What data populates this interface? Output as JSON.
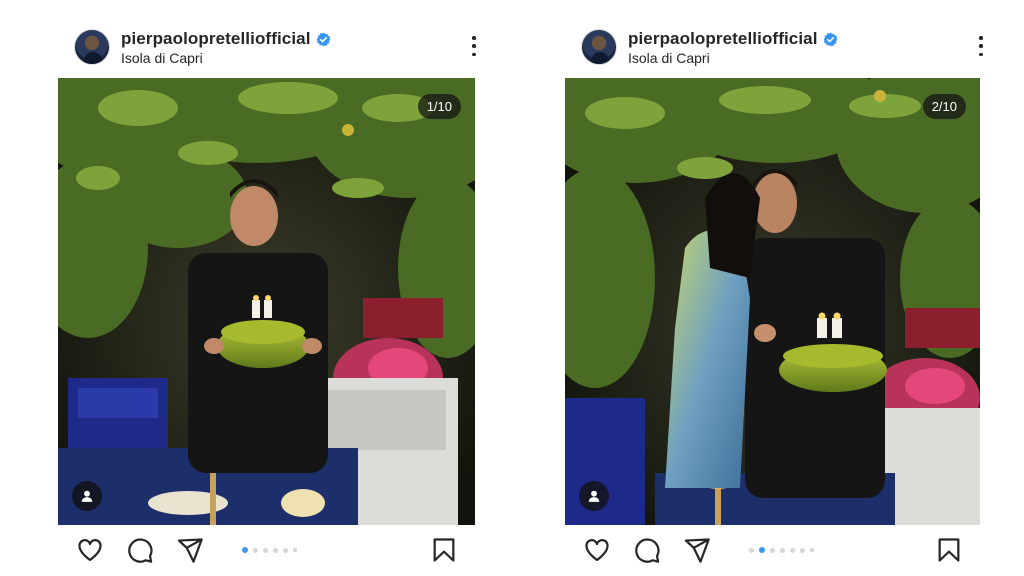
{
  "posts": [
    {
      "username": "pierpaolopretelliofficial",
      "location": "Isola di Capri",
      "counter": "1/10",
      "carousel": {
        "total_dots": 6,
        "active_index": 0
      }
    },
    {
      "username": "pierpaolopretelliofficial",
      "location": "Isola di Capri",
      "counter": "2/10",
      "carousel": {
        "total_dots": 7,
        "active_index": 1
      }
    }
  ],
  "icons": [
    "verified-badge-icon",
    "more-options-icon",
    "user-tag-icon",
    "heart-icon",
    "comment-icon",
    "share-icon",
    "bookmark-icon"
  ],
  "colors": {
    "verified": "#3897f0",
    "active_dot": "#3897f0",
    "inactive_dot": "#d6d6d6",
    "text": "#262626"
  }
}
